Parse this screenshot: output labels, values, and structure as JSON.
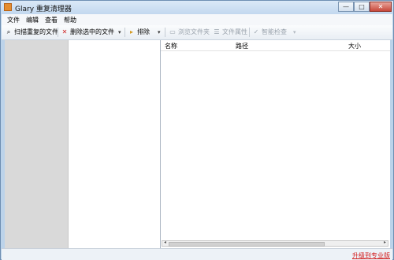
{
  "window": {
    "title": "Glary 重复清理器",
    "controls": {
      "minimize_label": "—",
      "maximize_label": "□",
      "close_label": "✕"
    }
  },
  "menu": [
    {
      "label": "文件"
    },
    {
      "label": "编辑"
    },
    {
      "label": "查看"
    },
    {
      "label": "帮助"
    }
  ],
  "toolbar": {
    "scan_label": "扫描重复的文件",
    "delete_label": "删除选中的文件",
    "exclude_label": "排除",
    "browse_label": "浏览文件夹",
    "properties_label": "文件属性",
    "smart_check_label": "智能检查",
    "dropdown_symbol": "▾"
  },
  "table": {
    "columns": [
      {
        "label": "名称"
      },
      {
        "label": "路径"
      },
      {
        "label": "大小"
      }
    ],
    "scroll_left_symbol": "◂",
    "scroll_right_symbol": "▸"
  },
  "status": {
    "link_label": "升级到专业版"
  },
  "icons": {
    "app": "app-icon",
    "scan": "search-icon",
    "delete": "delete-icon",
    "exclude": "exclude-icon",
    "browse": "folder-icon",
    "properties": "properties-icon",
    "smart_check": "checkmark-icon",
    "dropdown": "chevron-down-icon"
  },
  "colors": {
    "window_border": "#6f8fb3",
    "accent_red": "#d21818",
    "sidebar_bg": "#d9d9d9"
  }
}
